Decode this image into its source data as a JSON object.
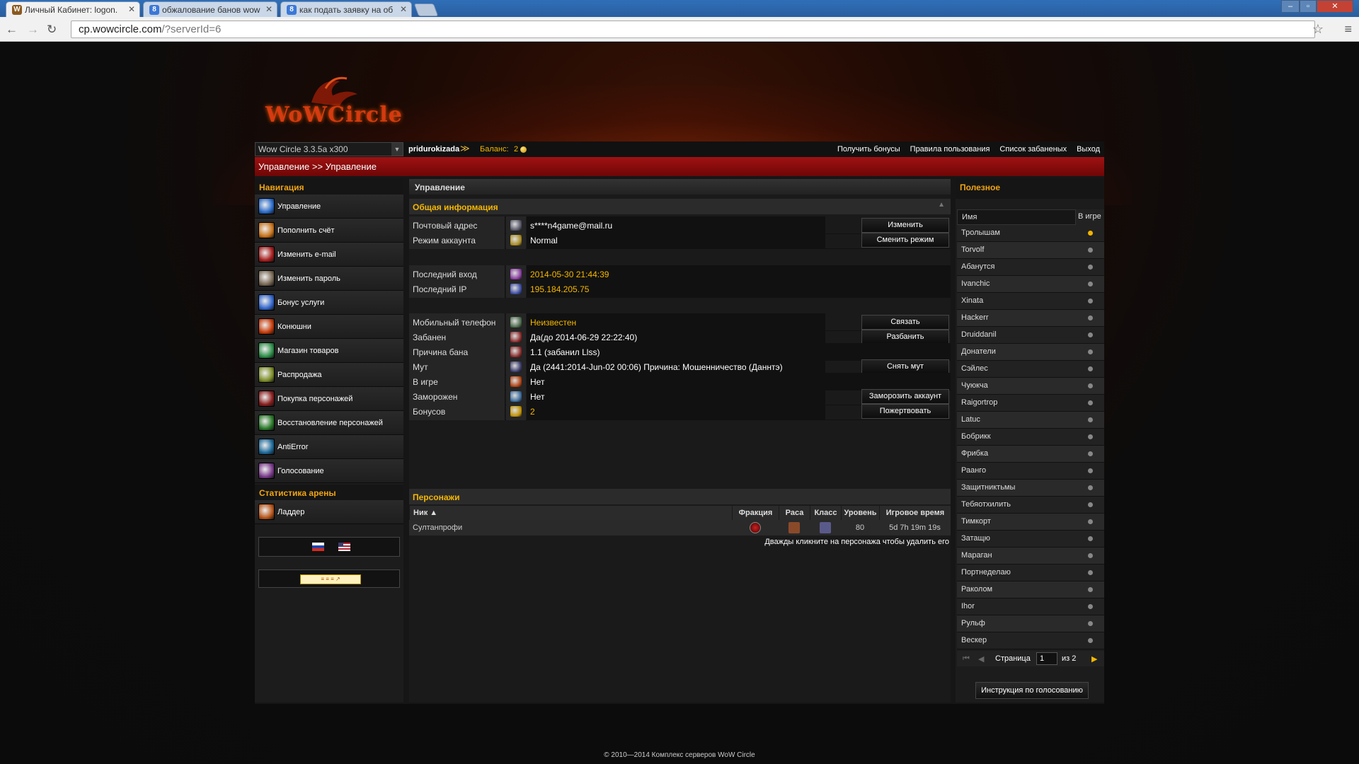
{
  "browser": {
    "tabs": [
      {
        "title": "Личный Кабинет: logon.",
        "favicon": "W"
      },
      {
        "title": "обжалование банов wow",
        "favicon": "8"
      },
      {
        "title": "как подать заявку на об",
        "favicon": "8"
      }
    ],
    "url_host": "cp.wowcircle.com",
    "url_path": "/?serverId=6"
  },
  "site": {
    "logo": "WoWCircle",
    "server_select": "Wow Circle 3.3.5a x300",
    "username": "pridurokizada",
    "balance_label": "Баланс:",
    "balance_value": "2",
    "top_links": [
      "Получить бонусы",
      "Правила пользования",
      "Список забаненых",
      "Выход"
    ],
    "breadcrumb": "Управление >> Управление"
  },
  "nav": {
    "title": "Навигация",
    "items": [
      {
        "label": "Управление",
        "icon": "control-icon",
        "color": "#2a6bc9"
      },
      {
        "label": "Пополнить счёт",
        "icon": "topup-icon",
        "color": "#c9741a"
      },
      {
        "label": "Изменить e-mail",
        "icon": "email-icon",
        "color": "#a81e1e"
      },
      {
        "label": "Изменить пароль",
        "icon": "password-icon",
        "color": "#7a6a55"
      },
      {
        "label": "Бонус услуги",
        "icon": "bonus-icon",
        "color": "#3366cc"
      },
      {
        "label": "Конюшни",
        "icon": "stable-icon",
        "color": "#c83c0a"
      },
      {
        "label": "Магазин товаров",
        "icon": "shop-icon",
        "color": "#2e8f4a"
      },
      {
        "label": "Распродажа",
        "icon": "sale-icon",
        "color": "#7f8f2a"
      },
      {
        "label": "Покупка персонажей",
        "icon": "buy-character-icon",
        "color": "#8a1e1e"
      },
      {
        "label": "Восстановление персонажей",
        "icon": "restore-character-icon",
        "color": "#2a7a2a"
      },
      {
        "label": "AntiError",
        "icon": "antierror-icon",
        "color": "#1e6a9a"
      },
      {
        "label": "Голосование",
        "icon": "vote-icon",
        "color": "#7a3a8a"
      }
    ],
    "arena_title": "Статистика арены",
    "arena_items": [
      {
        "label": "Ладдер",
        "icon": "ladder-icon",
        "color": "#b8551a"
      }
    ]
  },
  "main": {
    "title": "Управление",
    "section_title": "Общая информация",
    "rows": [
      {
        "label": "Почтовый адрес",
        "value": "s****n4game@mail.ru",
        "button": "Изменить",
        "highlight": false
      },
      {
        "label": "Режим аккаунта",
        "value": "Normal",
        "button": "Сменить режим",
        "highlight": false
      },
      {
        "label": "Последний вход",
        "value": "2014-05-30 21:44:39",
        "button": "",
        "highlight": true
      },
      {
        "label": "Последний IP",
        "value": "195.184.205.75",
        "button": "",
        "highlight": true
      },
      {
        "label": "Мобильный телефон",
        "value": "Неизвестен",
        "button": "Связать",
        "highlight": true
      },
      {
        "label": "Забанен",
        "value": "Да(до 2014-06-29 22:22:40)",
        "button": "Разбанить",
        "highlight": false
      },
      {
        "label": "Причина бана",
        "value": "1.1 (забанил Llss)",
        "button": "",
        "highlight": false
      },
      {
        "label": "Мут",
        "value": "Да (2441:2014-Jun-02 00:06) Причина: Мошенничество (Даннтэ)",
        "button": "Снять мут",
        "highlight": false
      },
      {
        "label": "В игре",
        "value": "Нет",
        "button": "",
        "highlight": false
      },
      {
        "label": "Заморожен",
        "value": "Нет",
        "button": "Заморозить аккаунт",
        "highlight": false
      },
      {
        "label": "Бонусов",
        "value": "2",
        "button": "Пожертвовать",
        "highlight": true
      }
    ],
    "characters_title": "Персонажи",
    "characters_columns": [
      "Ник ▲",
      "Фракция",
      "Раса",
      "Класс",
      "Уровень",
      "Игровое время"
    ],
    "characters": [
      {
        "name": "Султанпрофи",
        "level": "80",
        "playtime": "5d 7h 19m 19s"
      }
    ],
    "characters_hint": "Дважды кликните на персонажа чтобы удалить его"
  },
  "useful": {
    "title": "Полезное",
    "col_name": "Имя",
    "col_online": "В игре",
    "players": [
      {
        "name": "Тролышам",
        "online": true
      },
      {
        "name": "Torvolf",
        "online": false
      },
      {
        "name": "Абанутся",
        "online": false
      },
      {
        "name": "Ivanchic",
        "online": false
      },
      {
        "name": "Xinata",
        "online": false
      },
      {
        "name": "Hackerr",
        "online": false
      },
      {
        "name": "Druiddanil",
        "online": false
      },
      {
        "name": "Донатели",
        "online": false
      },
      {
        "name": "Сэйлес",
        "online": false
      },
      {
        "name": "Чуюкча",
        "online": false
      },
      {
        "name": "Raigortrop",
        "online": false
      },
      {
        "name": "Latuc",
        "online": false
      },
      {
        "name": "Бобрикк",
        "online": false
      },
      {
        "name": "Фрибка",
        "online": false
      },
      {
        "name": "Раанго",
        "online": false
      },
      {
        "name": "Защитниктьмы",
        "online": false
      },
      {
        "name": "Тебяотхилить",
        "online": false
      },
      {
        "name": "Тимкорт",
        "online": false
      },
      {
        "name": "Затащю",
        "online": false
      },
      {
        "name": "Мараган",
        "online": false
      },
      {
        "name": "Портнеделаю",
        "online": false
      },
      {
        "name": "Раколом",
        "online": false
      },
      {
        "name": "Ihor",
        "online": false
      },
      {
        "name": "Рульф",
        "online": false
      },
      {
        "name": "Вескер",
        "online": false
      }
    ],
    "page_label": "Страница",
    "page_value": "1",
    "page_of": "из 2",
    "vote_button": "Инструкция по голосованию"
  },
  "footer": "© 2010—2014 Комплекс серверов WoW Circle"
}
